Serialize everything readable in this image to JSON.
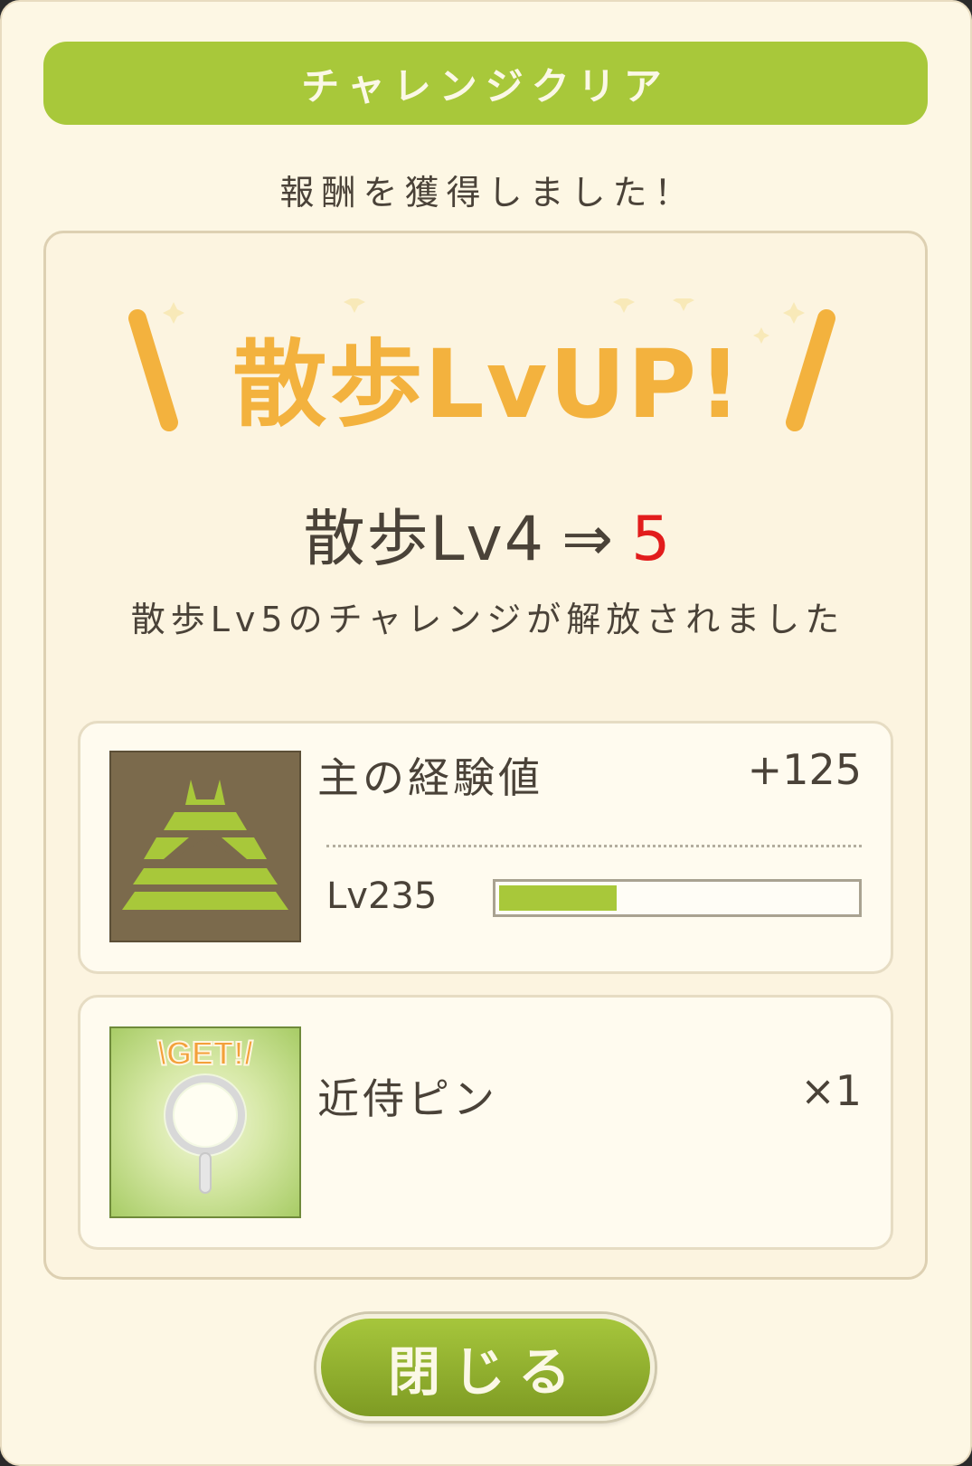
{
  "dialog": {
    "title": "チャレンジクリア",
    "subtitle": "報酬を獲得しました！"
  },
  "level_up": {
    "banner": "散歩LvUP!",
    "before": "散歩Lv4",
    "arrow": "⇒",
    "after": "5",
    "message": "散歩Lv5のチャレンジが解放されました"
  },
  "rewards": {
    "exp": {
      "label": "主の経験値",
      "amount": "+125",
      "level": "Lv235",
      "progress": 0.33,
      "icon": "castle-icon"
    },
    "item": {
      "badge": "\\GET!/",
      "name": "近侍ピン",
      "quantity": "×1",
      "icon": "magnifier-pin-icon"
    }
  },
  "buttons": {
    "close_label": "閉じる"
  },
  "colors": {
    "accent_green": "#a8c83a",
    "banner_orange": "#f3b23e",
    "highlight_red": "#e21c1c",
    "text_brown": "#4a4238"
  }
}
